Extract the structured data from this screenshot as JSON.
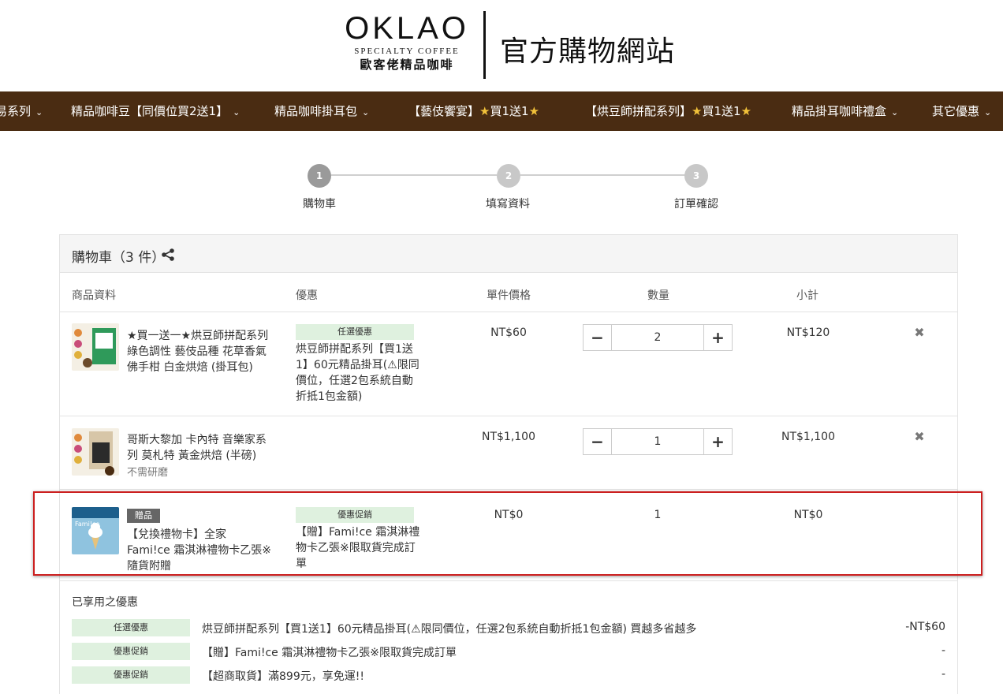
{
  "header": {
    "logo_main": "OKLAO",
    "logo_sub": "SPECIALTY COFFEE",
    "logo_cn": "歐客佬精品咖啡",
    "site_title": "官方購物網站"
  },
  "nav": {
    "items": [
      {
        "label": "易系列",
        "has_chevron": true
      },
      {
        "label": "精品咖啡豆【同價位買2送1】",
        "has_chevron": true
      },
      {
        "label": "精品咖啡掛耳包",
        "has_chevron": true
      },
      {
        "label_pre": "【藝伎饗宴】",
        "label_post": "買1送1",
        "stars": true
      },
      {
        "label_pre": "【烘豆師拼配系列】",
        "label_post": "買1送1",
        "stars": true
      },
      {
        "label": "精品掛耳咖啡禮盒",
        "has_chevron": true
      },
      {
        "label": "其它優惠",
        "has_chevron": true
      }
    ],
    "star_glyph": "★"
  },
  "steps": [
    {
      "number": "1",
      "label": "購物車",
      "active": true
    },
    {
      "number": "2",
      "label": "填寫資料",
      "active": false
    },
    {
      "number": "3",
      "label": "訂單確認",
      "active": false
    }
  ],
  "cart": {
    "title": "購物車（3 件）",
    "columns": [
      "商品資料",
      "優惠",
      "單件價格",
      "數量",
      "小計"
    ],
    "items": [
      {
        "name": "★買一送一★烘豆師拼配系列 綠色調性 藝伎品種 花草香氣 佛手柑 白金烘焙 (掛耳包)",
        "promo_tag": "任選優惠",
        "promo_text": "烘豆師拼配系列【買1送1】60元精品掛耳(⚠限同價位，任選2包系統自動折抵1包金額)",
        "unit_price": "NT$60",
        "quantity": "2",
        "subtotal": "NT$120"
      },
      {
        "name": "哥斯大黎加 卡內特 音樂家系列 莫札特 黃金烘焙 (半磅)",
        "note": "不需研磨",
        "unit_price": "NT$1,100",
        "quantity": "1",
        "subtotal": "NT$1,100"
      },
      {
        "badge": "贈品",
        "name": "【兌換禮物卡】全家 Fami!ce 霜淇淋禮物卡乙張※隨貨附贈",
        "promo_tag": "優惠促銷",
        "promo_text": "【贈】Fami!ce 霜淇淋禮物卡乙張※限取貨完成訂單",
        "unit_price": "NT$0",
        "quantity": "1",
        "subtotal": "NT$0"
      }
    ],
    "thumb_text": "Fami!ce"
  },
  "applied": {
    "title": "已享用之優惠",
    "rows": [
      {
        "tag": "任選優惠",
        "text": "烘豆師拼配系列【買1送1】60元精品掛耳(⚠限同價位，任選2包系統自動折抵1包金額) 買越多省越多",
        "amount": "-NT$60"
      },
      {
        "tag": "優惠促銷",
        "text": "【贈】Fami!ce 霜淇淋禮物卡乙張※限取貨完成訂單",
        "amount": "-"
      },
      {
        "tag": "優惠促銷",
        "text": "【超商取貨】滿899元，享免運!!",
        "amount": "-"
      }
    ]
  },
  "icons": {
    "minus": "−",
    "plus": "+",
    "remove": "✖",
    "chevron": "⌄"
  },
  "colors": {
    "nav_bg": "#4a2c12",
    "promo_tag_bg": "#dff1df",
    "highlight": "#cc1f1f"
  }
}
